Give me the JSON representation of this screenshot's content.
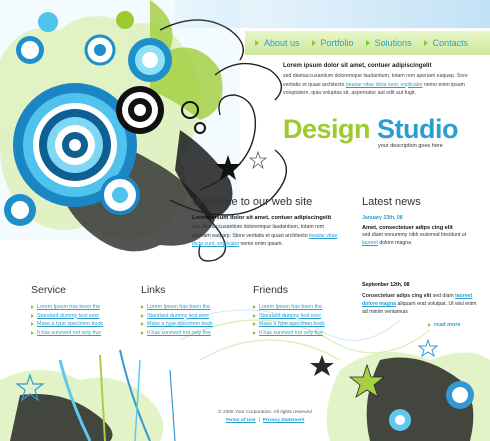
{
  "nav": {
    "items": [
      "About us",
      "Portfolio",
      "Solutions",
      "Contacts"
    ]
  },
  "intro": {
    "title": "Lorem ipsum dolor sit amet, contuer adipiscingelit",
    "text_before": "sed diamaccusantium doloremque laudantium, totam rem aperiam eaquep. Sore veritatis et quasi architecto ",
    "link": "beatae vitae dicta sunt, explicabo",
    "text_after": " nemo enim ipsam voluptatem, quia voluptas sit, aspernatur aut odit aut fugit."
  },
  "brand": {
    "word1": "Design",
    "word2": "Studio",
    "tagline": "your description goes here"
  },
  "welcome": {
    "heading": "Welcome to our web site",
    "bold": "Lorem ipsum dolor sit amet, contuer adipiscingelit",
    "text_before": "sed diamaccusantium doloremque laudantium, totam rem aperiam eaquep. Store veritatis et quasi architecto ",
    "link": "beatae vitae dicta sunt, explicabo",
    "text_after": " nemo enim ipsam."
  },
  "news": {
    "heading": "Latest news",
    "items": [
      {
        "date": "January 23th, 08",
        "headline": "Amet, consectetuer adips cing elit",
        "text_before": "sed diam nonummy nibh euismod tincidunt ut ",
        "link": "laoreet",
        "text_after": " dolore magna"
      },
      {
        "date": "September 12th, 08",
        "headline": "Consectetuer adips cing elit",
        "text_mid": " sed diam ",
        "link": "laoreet dolore magna",
        "text_after": " aliquam erat volutpat.   Ut wisi enim ad minim veniamuis"
      }
    ],
    "read_more": "read more"
  },
  "columns": [
    {
      "title": "Service",
      "links": [
        "Lorem Ipsum has been the",
        "Standard dummy text ever",
        "Make a type specimen book",
        "It has survived not only five"
      ]
    },
    {
      "title": "Links",
      "links": [
        "Lorem Ipsum has been the",
        "Standard dummy text ever",
        "Make a type specimen book",
        "It has survived not only five"
      ]
    },
    {
      "title": "Friends",
      "links": [
        "Lorem Ipsum has been the",
        "Standard dummy text ever",
        "Make a type specimen book",
        "It has survived not only five"
      ]
    }
  ],
  "footer": {
    "copyright": "© 2008 Your Corporation. All rights reserved",
    "terms": "Terms of Use",
    "separator": "|",
    "privacy": "Privacy Statement"
  },
  "colors": {
    "green": "#9ccb2f",
    "blue": "#2a9fcf",
    "nav_bg": "#cde99a"
  }
}
